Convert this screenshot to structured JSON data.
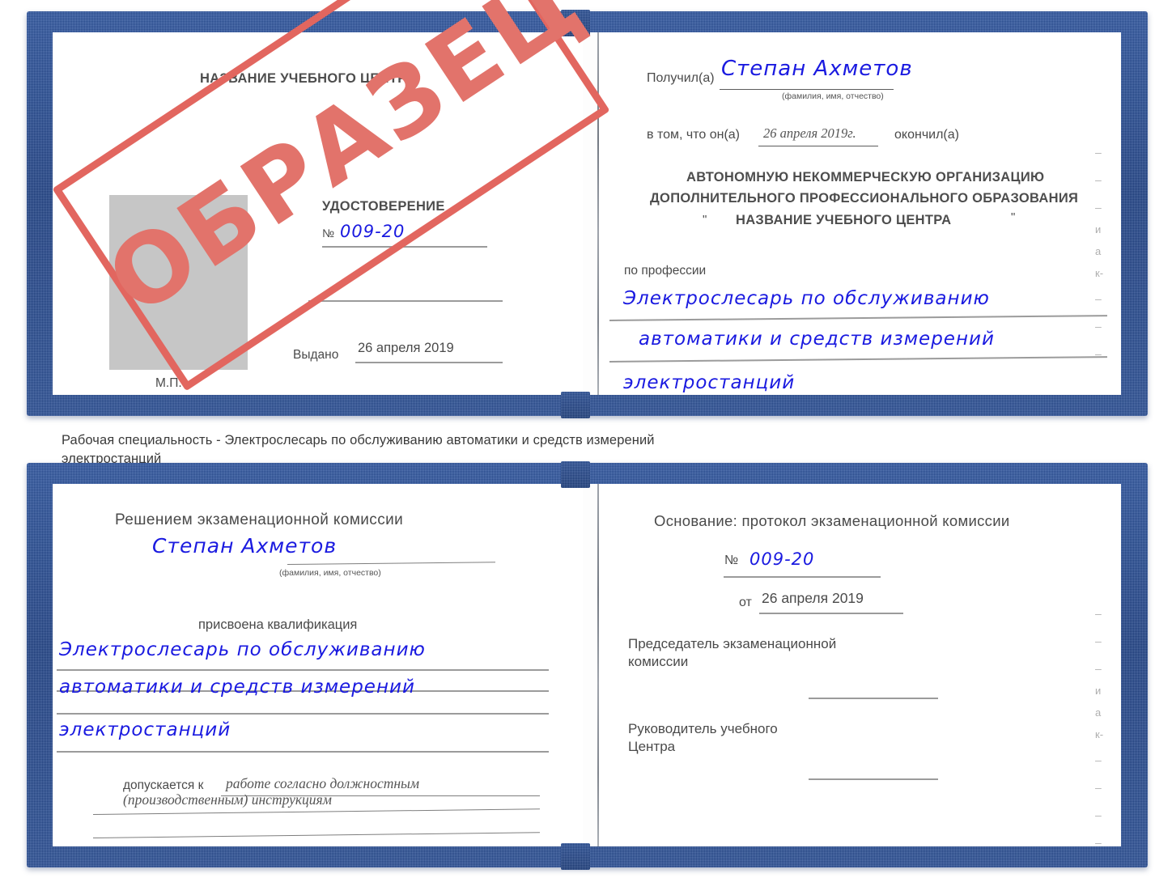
{
  "caption": {
    "line1": "Рабочая специальность - Электрослесарь по обслуживанию автоматики и средств измерений",
    "line2": "электростанций"
  },
  "stamp": {
    "text": "ОБРАЗЕЦ",
    "color": "#e2665f"
  },
  "colors": {
    "cover": "#1f4287",
    "ink": "#1a1ae0",
    "print": "#4a4a4a",
    "rule": "#9b9b9b",
    "photo_placeholder": "#c6c6c6"
  },
  "doc1": {
    "left_page": {
      "center_name": "НАЗВАНИЕ УЧЕБНОГО ЦЕНТРА",
      "title": "УДОСТОВЕРЕНИЕ",
      "number_label": "№",
      "number_value": "009-20",
      "issued_label": "Выдано",
      "issued_value": "26 апреля 2019",
      "seal_label": "М.П."
    },
    "right_page": {
      "received_label": "Получил(а)",
      "received_value": "Степан Ахметов",
      "fio_hint": "(фамилия, имя, отчество)",
      "that_he_label": "в том, что он(а)",
      "that_he_value": "26 апреля 2019г.",
      "finished_label": "окончил(а)",
      "org_line1": "АВТОНОМНУЮ НЕКОММЕРЧЕСКУЮ ОРГАНИЗАЦИЮ",
      "org_line2": "ДОПОЛНИТЕЛЬНОГО ПРОФЕССИОНАЛЬНОГО ОБРАЗОВАНИЯ",
      "org_quote_open": "\"",
      "org_line3": "НАЗВАНИЕ УЧЕБНОГО ЦЕНТРА",
      "org_quote_close": "\"",
      "profession_label": "по профессии",
      "profession_line1": "Электрослесарь по обслуживанию",
      "profession_line2": "автоматики и средств измерений",
      "profession_line3": "электростанций"
    }
  },
  "doc2": {
    "left_page": {
      "decision_label": "Решением экзаменационной комиссии",
      "name_value": "Степан Ахметов",
      "fio_hint": "(фамилия, имя, отчество)",
      "qualification_label": "присвоена квалификация",
      "qualification_line1": "Электрослесарь по обслуживанию",
      "qualification_line2": "автоматики и средств измерений",
      "qualification_line3": "электростанций",
      "allowed_label": "допускается к",
      "allowed_value_line1": "работе согласно должностным",
      "allowed_value_line2": "(производственным) инструкциям"
    },
    "right_page": {
      "basis_label": "Основание: протокол экзаменационной комиссии",
      "number_label": "№",
      "number_value": "009-20",
      "date_label": "от",
      "date_value": "26 апреля 2019",
      "chairman_line1": "Председатель экзаменационной",
      "chairman_line2": "комиссии",
      "head_line1": "Руководитель учебного",
      "head_line2": "Центра"
    }
  },
  "bleed_marks": {
    "doc1": [
      "–",
      "–",
      "–",
      "и",
      "а",
      "к-",
      "–",
      "–",
      "–"
    ],
    "doc2": [
      "–",
      "–",
      "–",
      "и",
      "а",
      "к-",
      "–",
      "–",
      "–",
      "–"
    ]
  }
}
